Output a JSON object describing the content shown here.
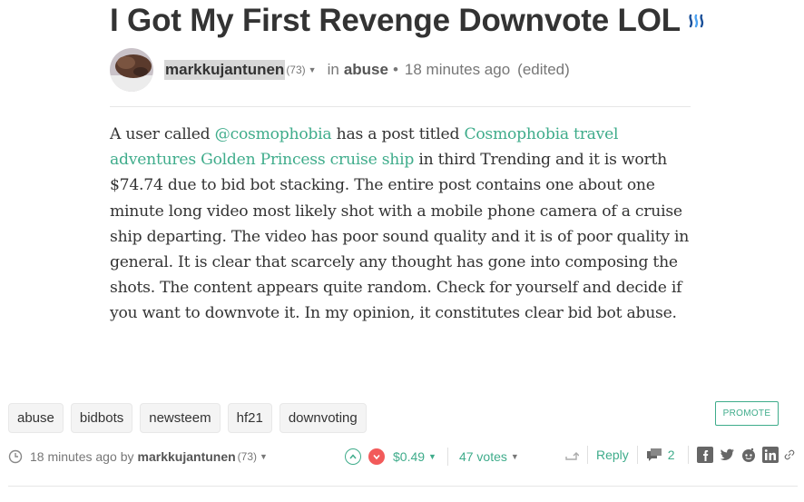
{
  "post": {
    "title": "I Got My First Revenge Downvote LOL",
    "author": "markkujantunen",
    "reputation": "(73)",
    "in_label": "in",
    "category": "abuse",
    "time": "18 minutes ago",
    "edited": "(edited)"
  },
  "body": {
    "t1": "A user called ",
    "link_user": "@cosmophobia",
    "t2": " has a post titled ",
    "link_post": "Cosmophobia travel adventures Golden Princess cruise ship",
    "t3": " in third Trending and it is worth $74.74 due to bid bot stacking. The entire post contains one about one minute long video most likely shot with a mobile phone camera of a cruise ship departing. The video has poor sound quality and it is of poor quality in general. It is clear that scarcely any thought has gone into composing the shots. The content appears quite random. Check for yourself and decide if you want to downvote it. In my opinion, it constitutes clear bid bot abuse."
  },
  "tags": [
    "abuse",
    "bidbots",
    "newsteem",
    "hf21",
    "downvoting"
  ],
  "promote_label": "PROMOTE",
  "footer": {
    "time": "18 minutes ago",
    "by": "by",
    "author": "markkujantunen",
    "reputation": "(73)",
    "payout": "$0.49",
    "votes": "47 votes",
    "reply": "Reply",
    "comments": "2"
  },
  "colors": {
    "accent": "#3fac8b",
    "downvote": "#f25a5a"
  }
}
